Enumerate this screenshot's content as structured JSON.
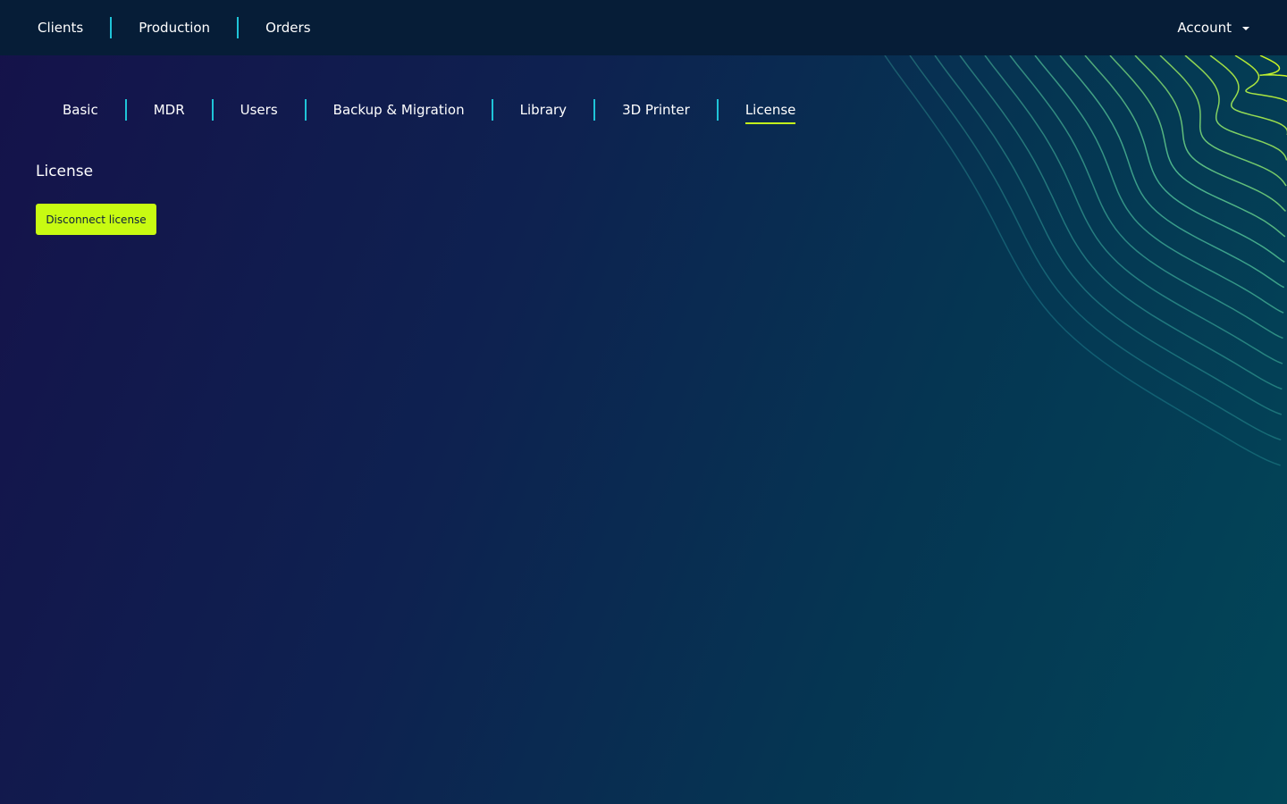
{
  "topnav": {
    "items": [
      {
        "label": "Clients"
      },
      {
        "label": "Production"
      },
      {
        "label": "Orders"
      }
    ],
    "account_label": "Account",
    "account_icon": "caret-down-icon"
  },
  "subnav": {
    "items": [
      {
        "label": "Basic",
        "active": false
      },
      {
        "label": "MDR",
        "active": false
      },
      {
        "label": "Users",
        "active": false
      },
      {
        "label": "Backup & Migration",
        "active": false
      },
      {
        "label": "Library",
        "active": false
      },
      {
        "label": "3D Printer",
        "active": false
      },
      {
        "label": "License",
        "active": true
      }
    ]
  },
  "main": {
    "section_title": "License",
    "disconnect_button_label": "Disconnect license"
  },
  "colors": {
    "accent": "#c8fb12",
    "separator": "#1fc4d8",
    "topbar_bg": "#061d37"
  }
}
